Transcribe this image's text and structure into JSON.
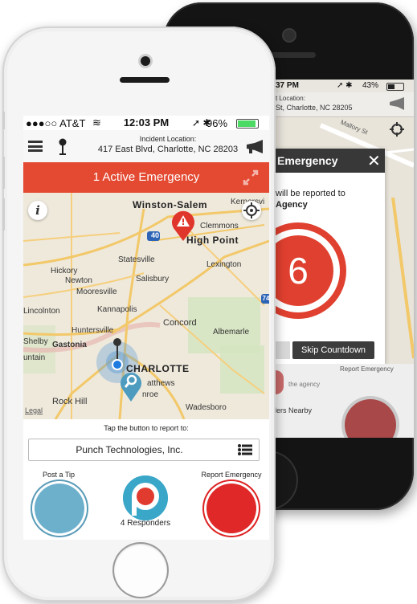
{
  "back_phone": {
    "status_time": "37 PM",
    "status_battery": "43%",
    "incident_label": "t Location:",
    "incident_address": "St, Charlotte, NC  28205",
    "map_street": "Mallory St",
    "modal": {
      "title": "Emergency",
      "body_line1": "will be reported to",
      "body_line2": "Agency",
      "countdown": "6",
      "skip_label": "Skip Countdown",
      "report_label": "Report Emergency",
      "agency_text": "the agency",
      "nearby_text": "ders Nearby"
    }
  },
  "front_phone": {
    "status": {
      "carrier": "●●●○○ AT&T",
      "time": "12:03 PM",
      "battery": "96%"
    },
    "header": {
      "location_label": "Incident Location:",
      "location_address": "417 East Blvd, Charlotte, NC  28203"
    },
    "emergency_banner": "1 Active Emergency",
    "map": {
      "interstate": "40",
      "interstate_2": "74",
      "legal": "Legal",
      "cities": [
        {
          "name": "Winston-Salem",
          "big": true
        },
        {
          "name": "Kernersvi",
          "big": false
        },
        {
          "name": "Clemmons",
          "big": false
        },
        {
          "name": "High Point",
          "big": true
        },
        {
          "name": "Statesville",
          "big": false
        },
        {
          "name": "Lexington",
          "big": false
        },
        {
          "name": "Hickory",
          "big": false
        },
        {
          "name": "Newton",
          "big": false
        },
        {
          "name": "Salisbury",
          "big": false
        },
        {
          "name": "Mooresville",
          "big": false
        },
        {
          "name": "Lincolnton",
          "big": false
        },
        {
          "name": "Kannapolis",
          "big": false
        },
        {
          "name": "Concord",
          "big": false
        },
        {
          "name": "Huntersville",
          "big": false
        },
        {
          "name": "Albemarle",
          "big": false
        },
        {
          "name": "Shelby",
          "big": false
        },
        {
          "name": "Gastonia",
          "big": false
        },
        {
          "name": "untain",
          "big": false
        },
        {
          "name": "CHARLOTTE",
          "big": true
        },
        {
          "name": "atthews",
          "big": false
        },
        {
          "name": "nroe",
          "big": false
        },
        {
          "name": "Rock Hill",
          "big": false
        },
        {
          "name": "Wadesboro",
          "big": false
        }
      ]
    },
    "bottom": {
      "prompt": "Tap the button to report to:",
      "organization": "Punch Technologies, Inc.",
      "tip_label": "Post a Tip",
      "responders": "4 Responders",
      "report_label": "Report Emergency"
    }
  },
  "colors": {
    "emergency_red": "#e44a32",
    "tip_blue": "#6db0cc",
    "report_red": "#e02828"
  }
}
